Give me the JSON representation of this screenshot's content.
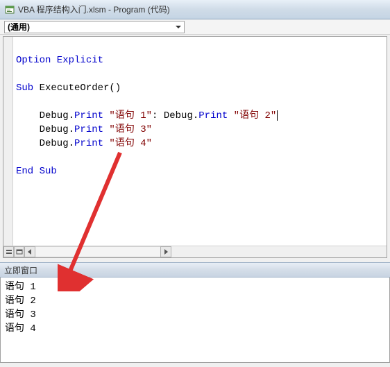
{
  "titlebar": {
    "title": "VBA 程序结构入门.xlsm - Program (代码)"
  },
  "dropdown": {
    "value": "(通用)"
  },
  "code": {
    "line1_kw": "Option Explicit",
    "line2_kw1": "Sub",
    "line2_name": " ExecuteOrder()",
    "line3_pfx": "    Debug.",
    "line3_kw": "Print",
    "line3_str1": " \"语句 1\"",
    "line3_sep": ": Debug.",
    "line3_kw2": "Print",
    "line3_str2": " \"语句 2\"",
    "line4_pfx": "    Debug.",
    "line4_kw": "Print",
    "line4_str": " \"语句 3\"",
    "line5_pfx": "    Debug.",
    "line5_kw": "Print",
    "line5_str": " \"语句 4\"",
    "line6_kw": "End Sub"
  },
  "immediate": {
    "title": "立即窗口",
    "lines": {
      "l1": "语句 1",
      "l2": "语句 2",
      "l3": "语句 3",
      "l4": "语句 4"
    }
  }
}
